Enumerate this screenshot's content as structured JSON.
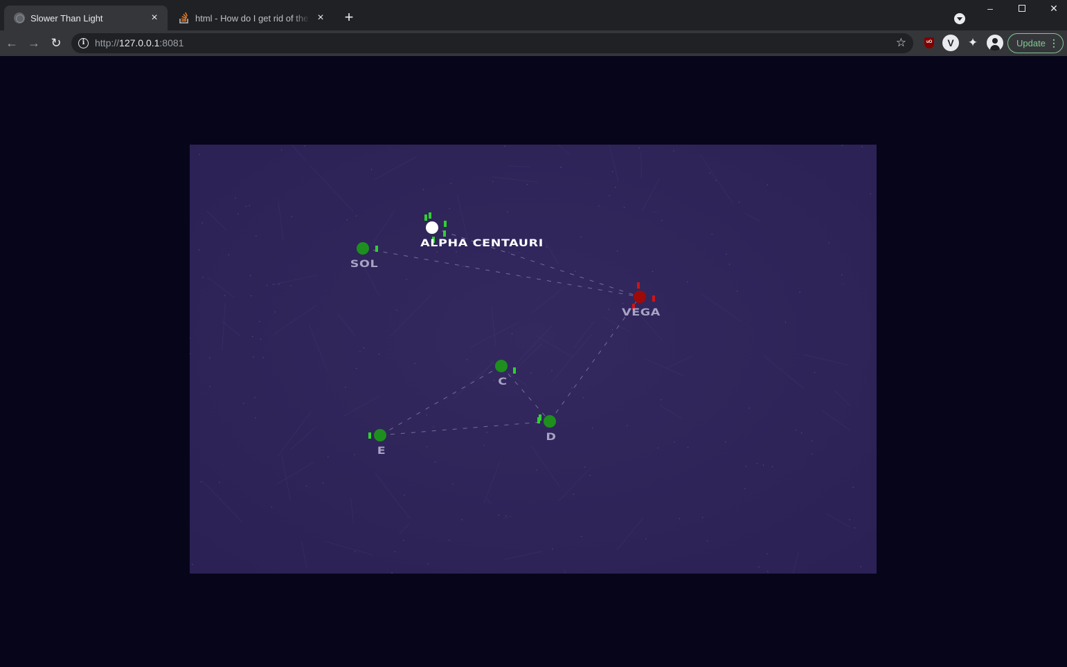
{
  "browser": {
    "tabs": [
      {
        "title": "Slower Than Light",
        "active": true
      },
      {
        "title": "html - How do I get rid of the scr",
        "active": false
      }
    ],
    "new_tab": "+",
    "window_controls": {
      "minimize": "–",
      "maximize": "",
      "close": "✕"
    },
    "nav": {
      "back": "←",
      "forward": "→",
      "reload": "↻"
    },
    "url": {
      "scheme": "http://",
      "host": "127.0.0.1",
      "port": ":8081"
    },
    "bookmark_icon": "☆",
    "extensions": {
      "ublock": "uO",
      "v": "V",
      "puzzle": "✦"
    },
    "update_label": "Update",
    "menu_dots": "⋮"
  },
  "game": {
    "colors": {
      "background": "#2e2458",
      "owned": "#1e8f1e",
      "enemy": "#9e0a0a",
      "current": "#ffffff",
      "ships_green": "#2fd12f",
      "ships_red": "#d11414",
      "lane": "#8a86b0"
    },
    "stars": [
      {
        "id": "sol",
        "label": "SOL",
        "owner": "player",
        "current": false
      },
      {
        "id": "alpha",
        "label": "ALPHA CENTAURI",
        "owner": "player",
        "current": true
      },
      {
        "id": "vega",
        "label": "VEGA",
        "owner": "enemy",
        "current": false
      },
      {
        "id": "c",
        "label": "C",
        "owner": "player",
        "current": false
      },
      {
        "id": "d",
        "label": "D",
        "owner": "player",
        "current": false
      },
      {
        "id": "e",
        "label": "E",
        "owner": "player",
        "current": false
      }
    ],
    "lanes": [
      [
        "sol",
        "vega"
      ],
      [
        "alpha",
        "vega"
      ],
      [
        "c",
        "d"
      ],
      [
        "c",
        "e"
      ],
      [
        "e",
        "d"
      ],
      [
        "d",
        "vega"
      ]
    ]
  }
}
